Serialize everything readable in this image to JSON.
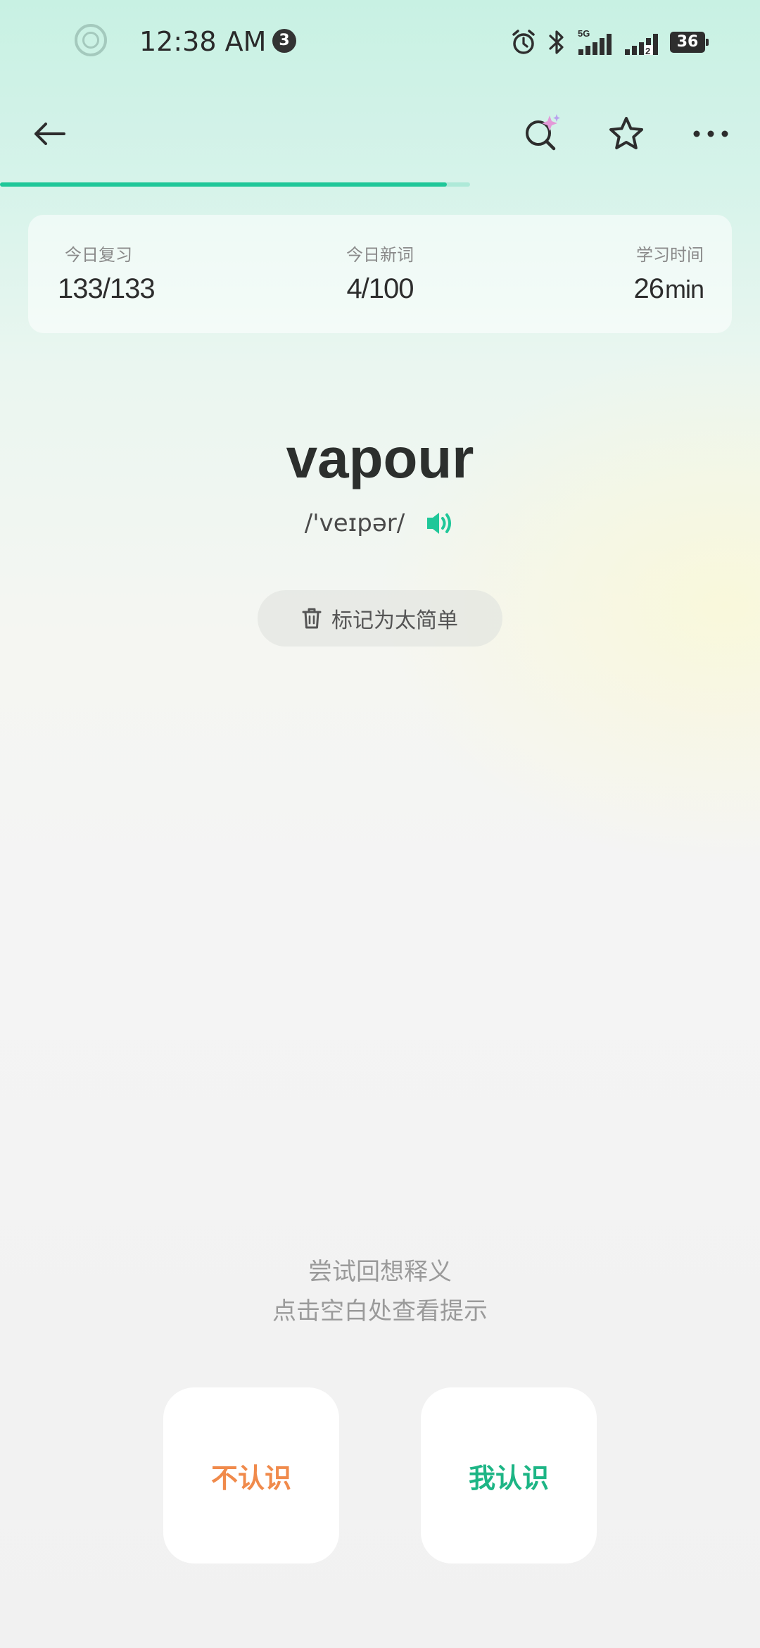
{
  "status_bar": {
    "time": "12:38 AM",
    "notification_count": "3",
    "network_label": "5G",
    "sim_slot": "2",
    "battery": "36"
  },
  "toolbar": {
    "back_icon": "arrow-left-icon",
    "search_icon": "ai-search-icon",
    "favorite_icon": "star-outline-icon",
    "more_icon": "more-horizontal-icon"
  },
  "progress": {
    "fraction": 0.95
  },
  "stats": {
    "review": {
      "label": "今日复习",
      "value": "133/133"
    },
    "new_words": {
      "label": "今日新词",
      "value": "4/100"
    },
    "study_time": {
      "label": "学习时间",
      "value": "26",
      "unit": "min"
    }
  },
  "word": {
    "text": "vapour",
    "phonetic": "/'veɪpər/",
    "speaker_icon": "speaker-icon"
  },
  "mark_easy": {
    "icon": "trash-icon",
    "label": "标记为太简单"
  },
  "hint": {
    "line1": "尝试回想释义",
    "line2": "点击空白处查看提示"
  },
  "answers": {
    "unknown_label": "不认识",
    "known_label": "我认识"
  },
  "colors": {
    "accent": "#1fc799",
    "unknown": "#f08a4b",
    "known": "#1db585"
  }
}
